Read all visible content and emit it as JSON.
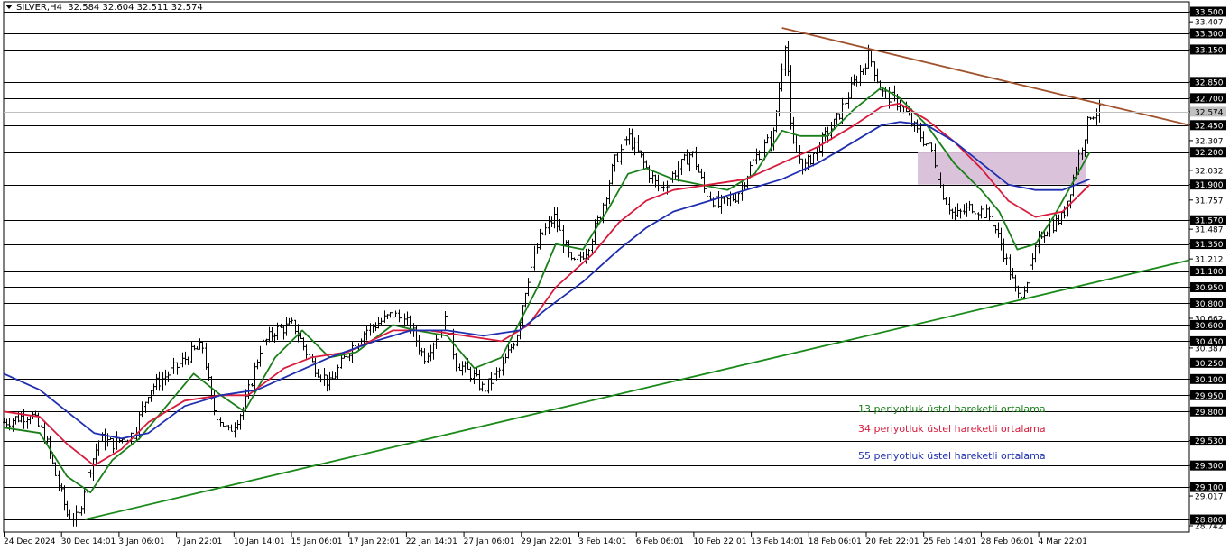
{
  "header": {
    "symbol": "SILVER,H4",
    "ohlc": "32.584 32.604 32.511 32.574"
  },
  "legend": [
    {
      "label": "13 periyotluk üstel hareketli ortalama",
      "color": "#1a7f1a"
    },
    {
      "label": "34 periyotluk üstel hareketli ortalama",
      "color": "#d81b3c"
    },
    {
      "label": "55 periyotluk üstel hareketli ortalama",
      "color": "#1f2fb0"
    }
  ],
  "chart_data": {
    "type": "line",
    "instrument": "SILVER,H4",
    "ylim": [
      28.742,
      33.5
    ],
    "price_axis_ticks": [
      "33.500",
      "33.407",
      "33.300",
      "33.150",
      "32.850",
      "32.700",
      "32.574",
      "32.450",
      "32.307",
      "32.200",
      "32.032",
      "31.900",
      "31.757",
      "31.570",
      "31.487",
      "31.350",
      "31.212",
      "31.100",
      "30.950",
      "30.800",
      "30.662",
      "30.600",
      "30.450",
      "30.387",
      "30.250",
      "30.100",
      "29.950",
      "29.800",
      "29.530",
      "29.300",
      "29.100",
      "29.017",
      "28.800",
      "28.742"
    ],
    "horizontal_levels": [
      33.5,
      33.3,
      33.15,
      32.85,
      32.7,
      32.45,
      32.2,
      31.9,
      31.57,
      31.35,
      31.1,
      30.95,
      30.8,
      30.6,
      30.45,
      30.25,
      30.1,
      29.95,
      29.8,
      29.53,
      29.3,
      29.1,
      28.8
    ],
    "current_price": "32.574",
    "time_axis_labels": [
      "24 Dec 2024",
      "30 Dec 14:01",
      "3 Jan 06:01",
      "7 Jan 22:01",
      "10 Jan 14:01",
      "15 Jan 06:01",
      "17 Jan 22:01",
      "22 Jan 14:01",
      "27 Jan 06:01",
      "29 Jan 22:01",
      "3 Feb 14:01",
      "6 Feb 06:01",
      "10 Feb 22:01",
      "13 Feb 14:01",
      "18 Feb 06:01",
      "20 Feb 22:01",
      "25 Feb 14:01",
      "28 Feb 06:01",
      "4 Mar 22:01"
    ],
    "price_path": [
      [
        0,
        29.7
      ],
      [
        1.5,
        29.78
      ],
      [
        2.3,
        29.55
      ],
      [
        2.8,
        29.25
      ],
      [
        3.5,
        28.85
      ],
      [
        4.1,
        28.8
      ],
      [
        4.6,
        29.2
      ],
      [
        5.3,
        29.55
      ],
      [
        6.0,
        29.5
      ],
      [
        7.2,
        29.6
      ],
      [
        8.0,
        30.0
      ],
      [
        9.1,
        30.15
      ],
      [
        9.8,
        30.25
      ],
      [
        10.4,
        30.35
      ],
      [
        11.0,
        30.4
      ],
      [
        11.5,
        29.85
      ],
      [
        12.4,
        29.6
      ],
      [
        13.3,
        29.85
      ],
      [
        14.2,
        30.4
      ],
      [
        15.0,
        30.55
      ],
      [
        16.0,
        30.6
      ],
      [
        17.0,
        30.25
      ],
      [
        18.0,
        30.05
      ],
      [
        19.0,
        30.35
      ],
      [
        20.0,
        30.55
      ],
      [
        21.5,
        30.7
      ],
      [
        22.4,
        30.6
      ],
      [
        23.2,
        30.3
      ],
      [
        24.4,
        30.65
      ],
      [
        25.0,
        30.25
      ],
      [
        25.8,
        30.15
      ],
      [
        26.5,
        30.0
      ],
      [
        27.5,
        30.2
      ],
      [
        28.3,
        30.5
      ],
      [
        28.9,
        31.0
      ],
      [
        29.6,
        31.4
      ],
      [
        30.4,
        31.6
      ],
      [
        31.4,
        31.15
      ],
      [
        32.2,
        31.3
      ],
      [
        33.0,
        31.65
      ],
      [
        33.7,
        32.1
      ],
      [
        34.5,
        32.35
      ],
      [
        35.5,
        32.05
      ],
      [
        36.2,
        31.85
      ],
      [
        37.0,
        32.0
      ],
      [
        38.0,
        32.2
      ],
      [
        38.7,
        31.85
      ],
      [
        39.5,
        31.7
      ],
      [
        40.5,
        31.8
      ],
      [
        41.5,
        32.15
      ],
      [
        42.5,
        32.35
      ],
      [
        43.2,
        33.3
      ],
      [
        43.5,
        32.3
      ],
      [
        44.2,
        32.05
      ],
      [
        45.0,
        32.25
      ],
      [
        46.0,
        32.5
      ],
      [
        47.0,
        32.85
      ],
      [
        47.8,
        33.1
      ],
      [
        48.5,
        32.75
      ],
      [
        49.5,
        32.65
      ],
      [
        50.4,
        32.4
      ],
      [
        51.3,
        32.2
      ],
      [
        51.8,
        31.85
      ],
      [
        52.5,
        31.6
      ],
      [
        53.5,
        31.7
      ],
      [
        54.5,
        31.6
      ],
      [
        55.2,
        31.3
      ],
      [
        56.0,
        30.85
      ],
      [
        56.6,
        31.05
      ],
      [
        57.3,
        31.45
      ],
      [
        58.5,
        31.6
      ],
      [
        59.2,
        32.05
      ],
      [
        60.0,
        32.55
      ],
      [
        60.5,
        32.574
      ]
    ],
    "series": [
      {
        "name": "13 periyotluk üstel hareketli ortalama",
        "color": "#1a7f1a",
        "points": [
          [
            0,
            29.65
          ],
          [
            2.0,
            29.6
          ],
          [
            3.5,
            29.2
          ],
          [
            4.8,
            29.05
          ],
          [
            6.0,
            29.35
          ],
          [
            7.5,
            29.55
          ],
          [
            9.0,
            29.85
          ],
          [
            10.5,
            30.15
          ],
          [
            12.0,
            29.95
          ],
          [
            13.3,
            29.8
          ],
          [
            15.0,
            30.3
          ],
          [
            16.5,
            30.55
          ],
          [
            18.0,
            30.3
          ],
          [
            19.5,
            30.35
          ],
          [
            21.5,
            30.6
          ],
          [
            22.8,
            30.55
          ],
          [
            24.5,
            30.5
          ],
          [
            26.0,
            30.2
          ],
          [
            27.5,
            30.3
          ],
          [
            29.5,
            30.95
          ],
          [
            30.5,
            31.35
          ],
          [
            32.0,
            31.3
          ],
          [
            33.5,
            31.7
          ],
          [
            34.5,
            32.0
          ],
          [
            35.5,
            32.05
          ],
          [
            37.0,
            31.95
          ],
          [
            38.5,
            31.9
          ],
          [
            40.0,
            31.85
          ],
          [
            41.5,
            32.0
          ],
          [
            43.0,
            32.4
          ],
          [
            44.0,
            32.35
          ],
          [
            45.5,
            32.35
          ],
          [
            47.0,
            32.6
          ],
          [
            48.5,
            32.8
          ],
          [
            49.5,
            32.7
          ],
          [
            51.0,
            32.45
          ],
          [
            52.5,
            32.1
          ],
          [
            54.0,
            31.85
          ],
          [
            55.0,
            31.65
          ],
          [
            56.0,
            31.3
          ],
          [
            57.0,
            31.35
          ],
          [
            58.0,
            31.6
          ],
          [
            59.0,
            31.9
          ],
          [
            60.0,
            32.2
          ]
        ]
      },
      {
        "name": "34 periyotluk üstel hareketli ortalama",
        "color": "#d81b3c",
        "points": [
          [
            0,
            29.8
          ],
          [
            2.0,
            29.75
          ],
          [
            3.5,
            29.5
          ],
          [
            5.0,
            29.3
          ],
          [
            6.5,
            29.45
          ],
          [
            8.0,
            29.7
          ],
          [
            10.0,
            29.9
          ],
          [
            12.0,
            29.95
          ],
          [
            13.5,
            29.95
          ],
          [
            15.5,
            30.2
          ],
          [
            17.0,
            30.3
          ],
          [
            19.0,
            30.35
          ],
          [
            21.5,
            30.55
          ],
          [
            23.5,
            30.55
          ],
          [
            25.5,
            30.5
          ],
          [
            27.5,
            30.45
          ],
          [
            29.0,
            30.6
          ],
          [
            30.5,
            30.95
          ],
          [
            32.5,
            31.25
          ],
          [
            34.0,
            31.55
          ],
          [
            35.5,
            31.75
          ],
          [
            37.0,
            31.85
          ],
          [
            39.0,
            31.9
          ],
          [
            41.0,
            31.95
          ],
          [
            43.0,
            32.1
          ],
          [
            45.0,
            32.25
          ],
          [
            47.0,
            32.45
          ],
          [
            48.5,
            32.62
          ],
          [
            49.5,
            32.65
          ],
          [
            51.0,
            32.5
          ],
          [
            52.5,
            32.3
          ],
          [
            54.0,
            32.05
          ],
          [
            55.5,
            31.75
          ],
          [
            57.0,
            31.6
          ],
          [
            58.5,
            31.65
          ],
          [
            60.0,
            31.9
          ]
        ]
      },
      {
        "name": "55 periyotluk üstel hareketli ortalama",
        "color": "#1f2fb0",
        "points": [
          [
            0,
            30.15
          ],
          [
            2.0,
            30.0
          ],
          [
            3.5,
            29.8
          ],
          [
            5.0,
            29.6
          ],
          [
            6.5,
            29.55
          ],
          [
            8.0,
            29.6
          ],
          [
            10.0,
            29.85
          ],
          [
            12.0,
            29.95
          ],
          [
            14.0,
            30.0
          ],
          [
            16.0,
            30.15
          ],
          [
            18.0,
            30.3
          ],
          [
            20.5,
            30.45
          ],
          [
            22.5,
            30.55
          ],
          [
            24.5,
            30.55
          ],
          [
            26.5,
            30.5
          ],
          [
            28.5,
            30.55
          ],
          [
            30.0,
            30.75
          ],
          [
            32.0,
            31.0
          ],
          [
            34.0,
            31.3
          ],
          [
            35.5,
            31.5
          ],
          [
            37.0,
            31.65
          ],
          [
            39.0,
            31.75
          ],
          [
            41.0,
            31.85
          ],
          [
            43.0,
            31.95
          ],
          [
            45.0,
            32.1
          ],
          [
            47.0,
            32.3
          ],
          [
            48.5,
            32.45
          ],
          [
            49.5,
            32.48
          ],
          [
            51.0,
            32.45
          ],
          [
            52.5,
            32.3
          ],
          [
            54.0,
            32.1
          ],
          [
            55.5,
            31.9
          ],
          [
            57.0,
            31.85
          ],
          [
            58.5,
            31.85
          ],
          [
            60.0,
            31.95
          ]
        ]
      }
    ],
    "trendlines": [
      {
        "name": "resistance",
        "color": "#a0522d",
        "points": [
          [
            43.0,
            33.35
          ],
          [
            65.5,
            32.45
          ]
        ]
      },
      {
        "name": "support",
        "color": "#1a8a1a",
        "points": [
          [
            4.5,
            28.8
          ],
          [
            65.5,
            31.2
          ]
        ]
      }
    ],
    "zone": {
      "color": "#d8bfd8",
      "x": [
        50.5,
        59.8
      ],
      "y": [
        31.9,
        32.2
      ]
    }
  }
}
